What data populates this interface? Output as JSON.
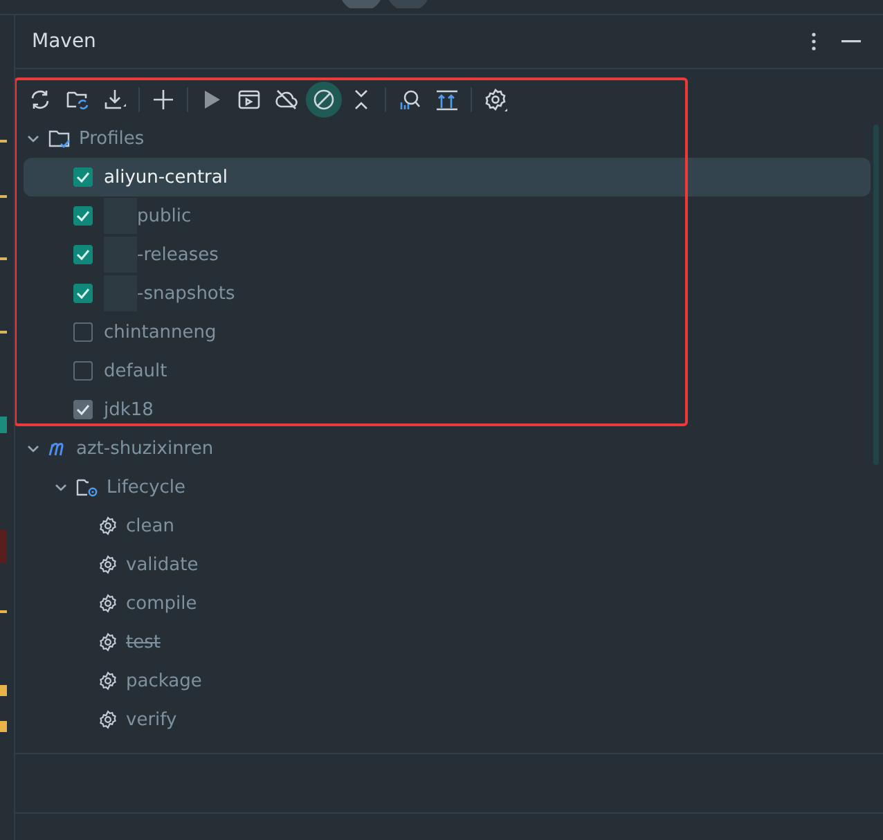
{
  "panel": {
    "title": "Maven"
  },
  "toolbar": [
    {
      "kind": "reload",
      "on": false
    },
    {
      "kind": "folder-sync",
      "on": false
    },
    {
      "kind": "download",
      "on": false
    },
    {
      "kind": "sep"
    },
    {
      "kind": "add",
      "on": false
    },
    {
      "kind": "sep"
    },
    {
      "kind": "run",
      "on": false
    },
    {
      "kind": "console",
      "on": false
    },
    {
      "kind": "offline",
      "on": false
    },
    {
      "kind": "skip",
      "on": true
    },
    {
      "kind": "collapse",
      "on": false
    },
    {
      "kind": "sep"
    },
    {
      "kind": "analyze",
      "on": false
    },
    {
      "kind": "expand",
      "on": false
    },
    {
      "kind": "sep"
    },
    {
      "kind": "settings",
      "on": false
    }
  ],
  "profiles": {
    "label": "Profiles",
    "expanded": true,
    "children": [
      {
        "name": "aliyun-central",
        "checked": true,
        "disabled": false,
        "selected": true
      },
      {
        "name": "public",
        "checked": true,
        "disabled": false,
        "selected": false,
        "redacted": true
      },
      {
        "name": "-releases",
        "checked": true,
        "disabled": false,
        "selected": false,
        "redacted": true
      },
      {
        "name": "-snapshots",
        "checked": true,
        "disabled": false,
        "selected": false,
        "redacted": true
      },
      {
        "name": "chintanneng",
        "checked": false,
        "disabled": false,
        "selected": false
      },
      {
        "name": "default",
        "checked": false,
        "disabled": false,
        "selected": false
      },
      {
        "name": "jdk18",
        "checked": true,
        "disabled": true,
        "selected": false
      }
    ]
  },
  "project": {
    "name": "azt-shuzixinren",
    "expanded": true,
    "children": [
      {
        "label": "Lifecycle",
        "expanded": true,
        "children": [
          {
            "name": "clean",
            "skipped": false
          },
          {
            "name": "validate",
            "skipped": false
          },
          {
            "name": "compile",
            "skipped": false
          },
          {
            "name": "test",
            "skipped": true
          },
          {
            "name": "package",
            "skipped": false
          },
          {
            "name": "verify",
            "skipped": false
          }
        ]
      }
    ]
  }
}
